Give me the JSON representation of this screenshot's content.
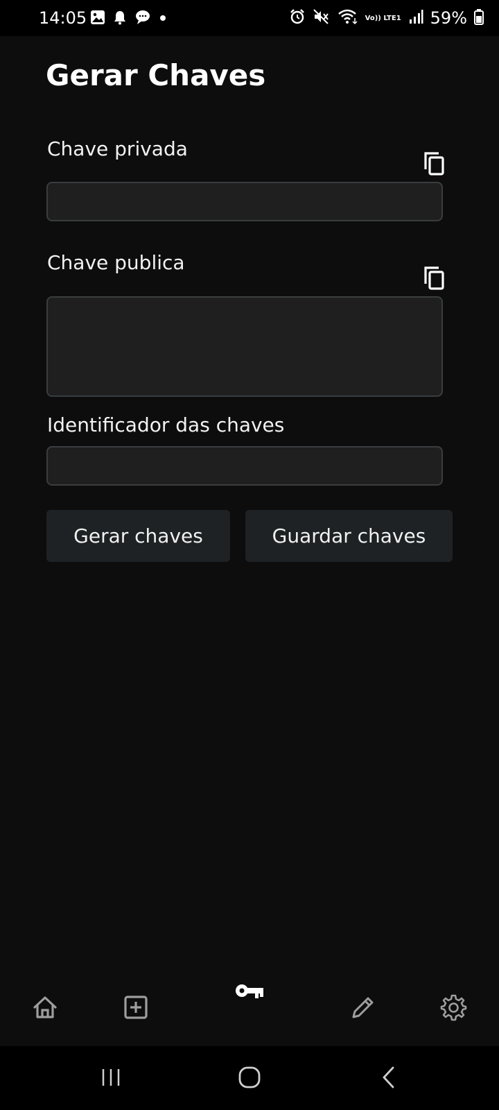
{
  "status_bar": {
    "time": "14:05",
    "battery": "59%",
    "icons_left": [
      "gallery-icon",
      "bell-icon",
      "chat-icon",
      "dot-icon"
    ],
    "icons_right": [
      "alarm-icon",
      "mute-icon",
      "wifi-icon",
      "volte-icon",
      "signal-icon",
      "battery-icon"
    ],
    "volte_text": "Vo)) LTE1"
  },
  "page": {
    "title": "Gerar Chaves"
  },
  "form": {
    "private_key_label": "Chave privada",
    "private_key_value": "",
    "public_key_label": "Chave publica",
    "public_key_value": "",
    "identifier_label": "Identificador das chaves",
    "identifier_value": ""
  },
  "actions": {
    "generate_label": "Gerar chaves",
    "save_label": "Guardar chaves"
  },
  "bottom_nav": {
    "items": [
      "home-icon",
      "add-box-icon",
      "key-icon",
      "edit-icon",
      "settings-icon"
    ],
    "active": "key-icon"
  },
  "colors": {
    "background": "#0d0d0d",
    "field_bg": "#1f1f1f",
    "field_border": "#3a3d3f",
    "button_bg": "#1e2224",
    "inactive_icon": "#9e9e9e",
    "active_icon": "#ffffff"
  }
}
